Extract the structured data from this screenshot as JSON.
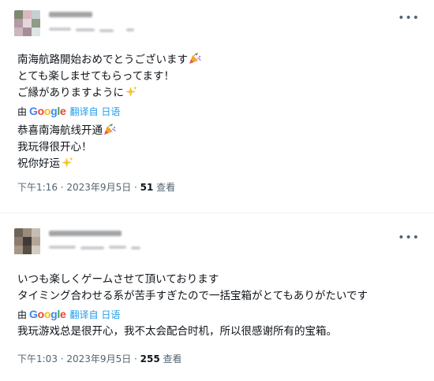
{
  "tweets": [
    {
      "original_lines": [
        "南海航路開始おめでとうございます",
        "とても楽しませてもらってます！",
        "ご縁がありますように"
      ],
      "translated_by_prefix": "由",
      "google_letters": [
        "G",
        "o",
        "o",
        "g",
        "l",
        "e"
      ],
      "translated_from": "翻译自 日语",
      "translated_lines": [
        "恭喜南海航线开通",
        "我玩得很开心！",
        "祝你好运"
      ],
      "time": "下午1:16 · 2023年9月5日 · ",
      "views_count": "51",
      "views_label": " 查看"
    },
    {
      "original_lines": [
        "いつも楽しくゲームさせて頂いております",
        "タイミング合わせる系が苦手すぎたので一括宝箱がとてもありがたいです"
      ],
      "translated_by_prefix": "由",
      "google_letters": [
        "G",
        "o",
        "o",
        "g",
        "l",
        "e"
      ],
      "translated_from": "翻译自 日语",
      "translated_lines": [
        "我玩游戏总是很开心，我不太会配合时机，所以很感谢所有的宝箱。"
      ],
      "time": "下午1:03 · 2023年9月5日 · ",
      "views_count": "255",
      "views_label": " 查看"
    }
  ],
  "more_glyph": "•••",
  "icons": {
    "party": "party-popper-icon",
    "sparkles": "sparkles-icon",
    "more": "more-options-icon"
  },
  "colors": {
    "link": "#1d9bf0",
    "secondary_text": "#536471",
    "primary_text": "#0f1419"
  }
}
